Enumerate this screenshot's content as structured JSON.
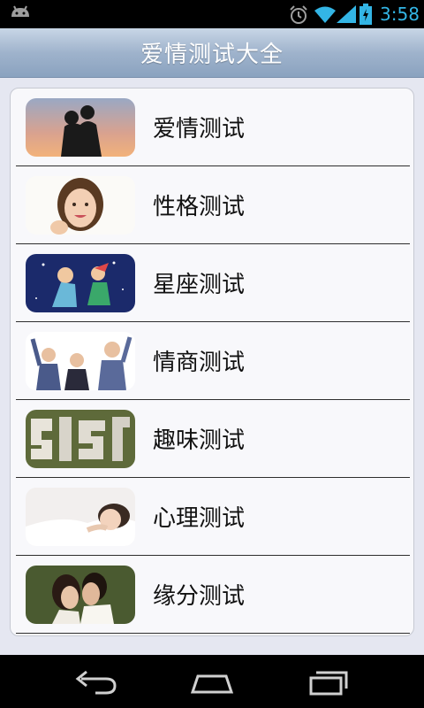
{
  "status_bar": {
    "time": "3:58",
    "icons": [
      "android-icon",
      "alarm-icon",
      "wifi-icon",
      "signal-icon",
      "battery-icon"
    ],
    "icon_color": "#33b5e5"
  },
  "app": {
    "title": "爱情测试大全"
  },
  "list": {
    "items": [
      {
        "label": "爱情测试",
        "thumb": "couple-silhouette-image"
      },
      {
        "label": "性格测试",
        "thumb": "smiling-girl-image"
      },
      {
        "label": "星座测试",
        "thumb": "constellation-art-image"
      },
      {
        "label": "情商测试",
        "thumb": "cheering-businessmen-image"
      },
      {
        "label": "趣味测试",
        "thumb": "maze-letters-image"
      },
      {
        "label": "心理测试",
        "thumb": "sleeping-woman-image"
      },
      {
        "label": "缘分测试",
        "thumb": "couple-kissing-image"
      }
    ]
  },
  "nav_bar": {
    "buttons": [
      "back-icon",
      "home-icon",
      "recents-icon"
    ]
  }
}
